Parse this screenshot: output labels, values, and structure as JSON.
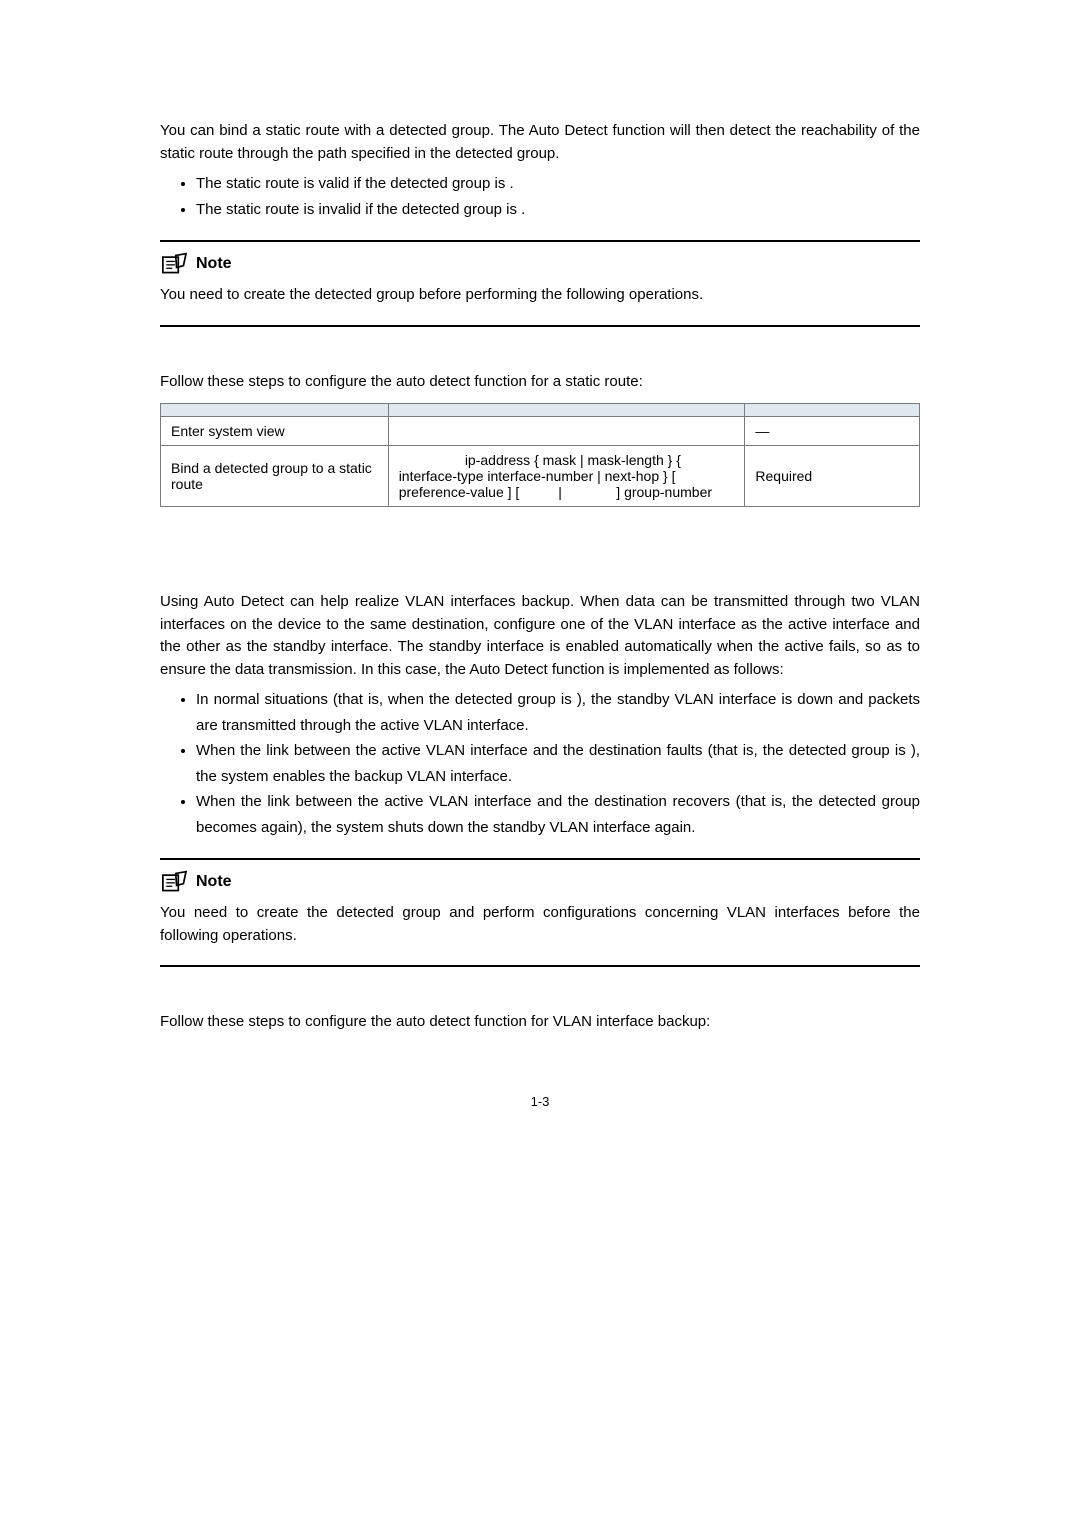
{
  "intro": {
    "p1": "You can bind a static route with a detected group. The Auto Detect function will then detect the reachability of the static route through the path specified in the detected group.",
    "b1": "The static route is valid if the detected group is              .",
    "b2": "The static route is invalid if the detected group is                 ."
  },
  "note1": {
    "label": "Note",
    "text": "You need to create the detected group before performing the following operations."
  },
  "table_caption": "Follow these steps to configure the auto detect function for a static route:",
  "table": {
    "h1": "",
    "h2": "",
    "h3": "",
    "r1c1": "Enter system view",
    "r1c2": "",
    "r1c3": "—",
    "r2c1": "Bind a detected group to a static route",
    "r2c2": "                 ip-address { mask | mask-length } { interface-type interface-number | next-hop } [ preference-value ] [          |              ] group-number",
    "r2c3": "Required"
  },
  "vlan": {
    "p1": "Using Auto Detect can help realize VLAN interfaces backup. When data can be transmitted through two VLAN interfaces on the device to the same destination, configure one of the VLAN interface as the active interface and the other as the standby interface. The standby interface is enabled automatically when the active fails, so as to ensure the data transmission. In this case, the Auto Detect function is implemented as follows:",
    "b1": "In normal situations (that is, when the detected group is                 ), the standby VLAN interface is down and packets are transmitted through the active VLAN interface.",
    "b2": "When the link between the active VLAN interface and the destination faults (that is, the detected group is                    ), the system enables the backup VLAN interface.",
    "b3": "When the link between the active VLAN interface and the destination recovers (that is, the detected group becomes                  again), the system shuts down the standby VLAN interface again."
  },
  "note2": {
    "label": "Note",
    "text": "You need to create the detected group and perform configurations concerning VLAN interfaces before the following operations."
  },
  "closing": "Follow these steps to configure the auto detect function for VLAN interface backup:",
  "page_number": "1-3"
}
